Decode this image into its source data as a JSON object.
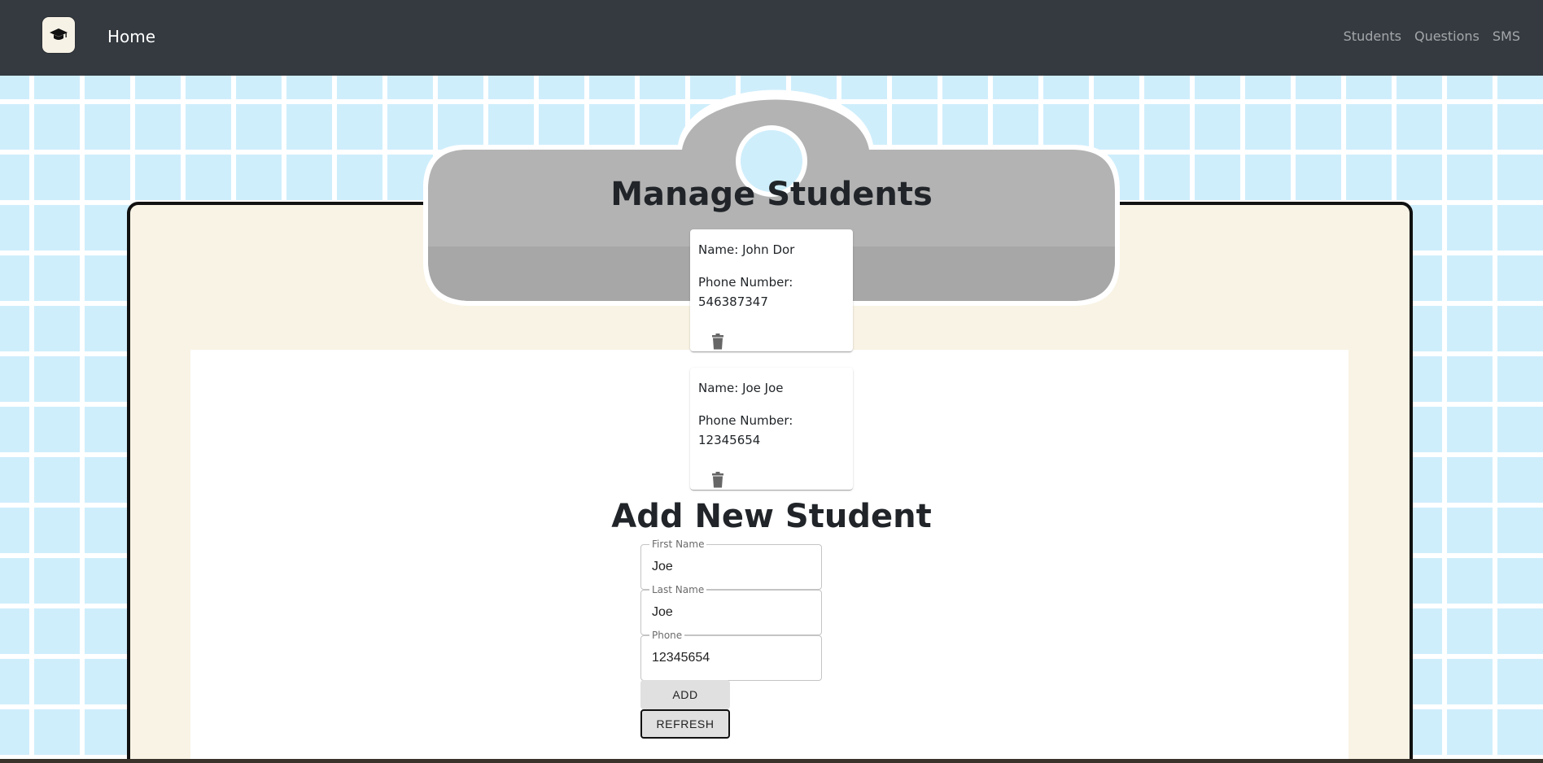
{
  "nav": {
    "brand_icon": "graduation-cap-icon",
    "home_label": "Home",
    "links": [
      {
        "label": "Students"
      },
      {
        "label": "Questions"
      },
      {
        "label": "SMS"
      }
    ]
  },
  "manage": {
    "title": "Manage Students",
    "students": [
      {
        "name": "Name: John Dor",
        "phone_label": "Phone Number:",
        "phone": "546387347",
        "delete_icon": "trash-icon"
      },
      {
        "name": "Name: Joe Joe",
        "phone_label": "Phone Number:",
        "phone": "12345654",
        "delete_icon": "trash-icon"
      }
    ]
  },
  "add": {
    "title": "Add New Student",
    "first_name": {
      "label": "First Name",
      "value": "Joe"
    },
    "last_name": {
      "label": "Last Name",
      "value": "Joe"
    },
    "phone": {
      "label": "Phone",
      "value": "12345654"
    },
    "add_button": "ADD",
    "refresh_button": "REFRESH"
  },
  "colors": {
    "navbar": "#343a40",
    "background": "#cfeefc",
    "grid": "#ffffff",
    "board": "#f9f3e5",
    "clip": "#b3b3b3"
  }
}
